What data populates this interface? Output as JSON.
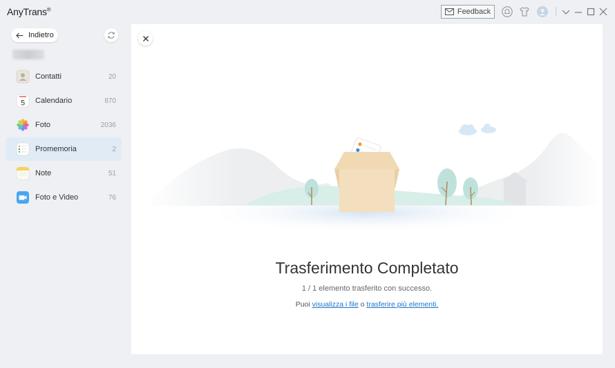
{
  "app": {
    "title": "AnyTrans",
    "trademark": "®",
    "feedback_label": "Feedback"
  },
  "sidebar": {
    "back_label": "Indietro",
    "items": [
      {
        "label": "Contatti",
        "count": "20",
        "icon": "contacts-icon"
      },
      {
        "label": "Calendario",
        "count": "870",
        "icon": "calendar-icon",
        "calendar_day": "5"
      },
      {
        "label": "Foto",
        "count": "2036",
        "icon": "photos-icon"
      },
      {
        "label": "Promemoria",
        "count": "2",
        "icon": "reminders-icon",
        "active": true
      },
      {
        "label": "Note",
        "count": "51",
        "icon": "notes-icon"
      },
      {
        "label": "Foto e Video",
        "count": "76",
        "icon": "photo-video-icon"
      }
    ]
  },
  "result": {
    "title": "Trasferimento Completato",
    "subtitle": "1 / 1 elemento trasferito con successo.",
    "links_prefix": "Puoi",
    "view_files_link": "visualizza i file",
    "links_middle": "o",
    "transfer_more_link": "trasferire più elementi."
  },
  "colors": {
    "accent": "#1a73c9",
    "active_item_bg": "#e1ebf6",
    "window_bg": "#eef0f3"
  }
}
